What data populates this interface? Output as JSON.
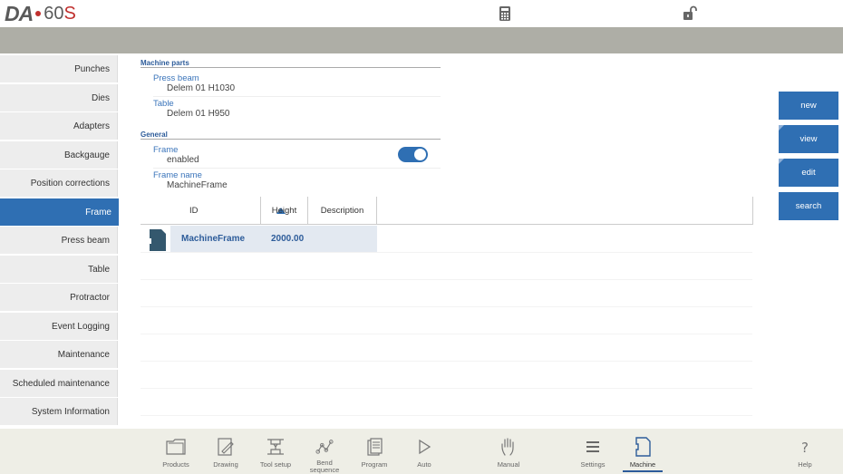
{
  "header": {
    "logo_brand": "DA",
    "logo_model": "60",
    "logo_model_suffix": "S",
    "icons": [
      "calculator-icon",
      "unlock-icon"
    ]
  },
  "sidebar": {
    "items": [
      {
        "label": "Punches"
      },
      {
        "label": "Dies"
      },
      {
        "label": "Adapters"
      },
      {
        "label": "Backgauge"
      },
      {
        "label": "Position corrections"
      },
      {
        "label": "Frame",
        "active": true
      },
      {
        "label": "Press beam"
      },
      {
        "label": "Table"
      },
      {
        "label": "Protractor"
      },
      {
        "label": "Event Logging"
      },
      {
        "label": "Maintenance"
      },
      {
        "label": "Scheduled maintenance"
      },
      {
        "label": "System Information"
      }
    ]
  },
  "machine_parts": {
    "title": "Machine parts",
    "press_beam_label": "Press beam",
    "press_beam_value": "Delem 01 H1030",
    "table_label": "Table",
    "table_value": "Delem 01 H950"
  },
  "general": {
    "title": "General",
    "frame_label": "Frame",
    "frame_value": "enabled",
    "frame_enabled": true,
    "frame_name_label": "Frame name",
    "frame_name_value": "MachineFrame"
  },
  "table": {
    "headers": {
      "id": "ID",
      "height": "Height",
      "description": "Description"
    },
    "sort": "ascending",
    "rows": [
      {
        "id": "MachineFrame",
        "height": "2000.00",
        "description": ""
      }
    ]
  },
  "actions": {
    "new": "new",
    "view": "view",
    "edit": "edit",
    "search": "search"
  },
  "bottom_nav": {
    "products": "Products",
    "drawing": "Drawing",
    "tool_setup": "Tool setup",
    "bend_sequence_1": "Bend",
    "bend_sequence_2": "sequence",
    "program": "Program",
    "auto": "Auto",
    "manual": "Manual",
    "settings": "Settings",
    "machine": "Machine",
    "help": "Help",
    "active": "Machine"
  },
  "colors": {
    "accent": "#2f6fb3",
    "header_bar": "#aeaea6",
    "bottom_bar": "#eeeee6",
    "sidebar_item": "#ededed"
  }
}
